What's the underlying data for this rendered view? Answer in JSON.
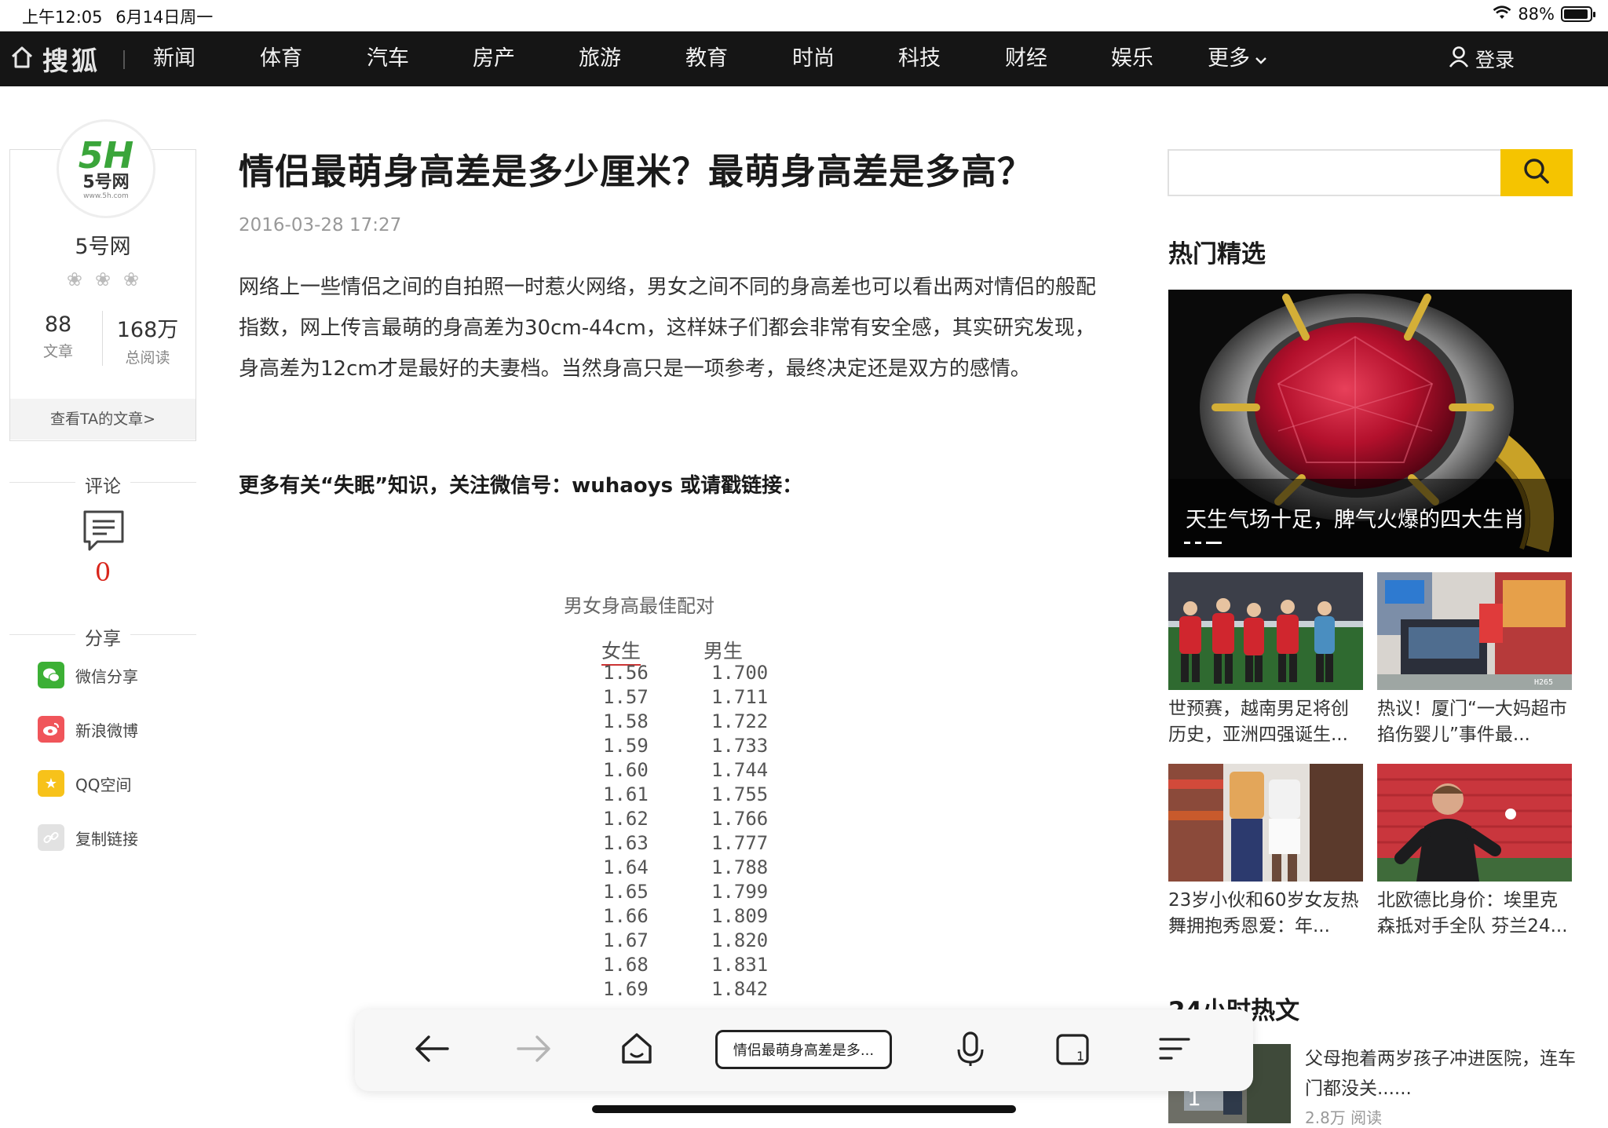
{
  "status_bar": {
    "time": "上午12:05",
    "date": "6月14日周一",
    "battery": "88%",
    "battery_level": 0.88
  },
  "top_nav": {
    "logo": "搜狐",
    "items": [
      "新闻",
      "体育",
      "汽车",
      "房产",
      "旅游",
      "教育",
      "时尚",
      "科技",
      "财经",
      "娱乐",
      "更多"
    ],
    "login": "登录"
  },
  "author": {
    "avatar_mark": "5H",
    "avatar_label": "5号网",
    "avatar_url": "www.5h.com",
    "name": "5号网",
    "articles_count": "88",
    "articles_label": "文章",
    "reads_count": "168万",
    "reads_label": "总阅读",
    "more_link": "查看TA的文章>"
  },
  "sidebar": {
    "comment_heading": "评论",
    "comment_count": "0",
    "share_heading": "分享",
    "share_items": [
      {
        "label": "微信分享",
        "color": "#3cb035"
      },
      {
        "label": "新浪微博",
        "color": "#f0555a"
      },
      {
        "label": "QQ空间",
        "color": "#f7c21a"
      },
      {
        "label": "复制链接",
        "color": "#d9d9d9"
      }
    ]
  },
  "article": {
    "title": "情侣最萌身高差是多少厘米？最萌身高差是多高？",
    "date": "2016-03-28 17:27",
    "body": "网络上一些情侣之间的自拍照一时惹火网络，男女之间不同的身高差也可以看出两对情侣的般配指数，网上传言最萌的身高差为30cm-44cm，这样妹子们都会非常有安全感，其实研究发现，身高差为12cm才是最好的夫妻档。当然身高只是一项参考，最终决定还是双方的感情。",
    "more": "更多有关“失眠”知识，关注微信号：wuhaoys 或请戳链接："
  },
  "figure": {
    "caption": "男女身高最佳配对",
    "header_female": "女生",
    "header_male": "男生",
    "rows": [
      [
        "1.56",
        "1.700"
      ],
      [
        "1.57",
        "1.711"
      ],
      [
        "1.58",
        "1.722"
      ],
      [
        "1.59",
        "1.733"
      ],
      [
        "1.60",
        "1.744"
      ],
      [
        "1.61",
        "1.755"
      ],
      [
        "1.62",
        "1.766"
      ],
      [
        "1.63",
        "1.777"
      ],
      [
        "1.64",
        "1.788"
      ],
      [
        "1.65",
        "1.799"
      ],
      [
        "1.66",
        "1.809"
      ],
      [
        "1.67",
        "1.820"
      ],
      [
        "1.68",
        "1.831"
      ],
      [
        "1.69",
        "1.842"
      ]
    ]
  },
  "right": {
    "search_placeholder": "",
    "hot_heading": "热门精选",
    "hero_caption": "天生气场十足，脾气火爆的四大生肖",
    "cards": [
      {
        "title": "世预赛，越南男足将创历史，亚洲四强诞生..."
      },
      {
        "title": "热议！厦门“一大妈超市掐伤婴儿”事件最..."
      },
      {
        "title": "23岁小伙和60岁女友热舞拥抱秀恩爱：年..."
      },
      {
        "title": "北欧德比身价：埃里克森抵对手全队 芬兰24..."
      }
    ],
    "hot24_heading": "24小时热文",
    "hot24_rank": "1",
    "hot24_title": "父母抱着两岁孩子冲进医院，连车门都没关......",
    "hot24_reads": "2.8万 阅读"
  },
  "browser": {
    "url_label": "情侣最萌身高差是多..."
  },
  "colors": {
    "nav_bg": "#151515",
    "accent_yellow": "#f5c400",
    "comment_red": "#d9261c"
  }
}
